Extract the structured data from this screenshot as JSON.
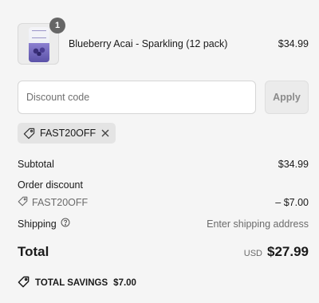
{
  "cart": {
    "item": {
      "name": "Blueberry Acai - Sparkling (12 pack)",
      "price": "$34.99",
      "quantity": "1",
      "thumbnail_icon": "sparkling-water-can"
    }
  },
  "discount": {
    "placeholder": "Discount code",
    "apply_label": "Apply",
    "applied_code": "FAST20OFF"
  },
  "summary": {
    "subtotal_label": "Subtotal",
    "subtotal_value": "$34.99",
    "order_discount_label": "Order discount",
    "discount_code": "FAST20OFF",
    "discount_value": "– $7.00",
    "shipping_label": "Shipping",
    "shipping_value": "Enter shipping address",
    "total_label": "Total",
    "currency": "USD",
    "total_value": "$27.99",
    "savings_label": "TOTAL SAVINGS",
    "savings_value": "$7.00"
  },
  "colors": {
    "background": "#f5f5f5",
    "badge": "#666666",
    "chip": "#e4e4e4",
    "apply_button": "#ebebeb"
  }
}
